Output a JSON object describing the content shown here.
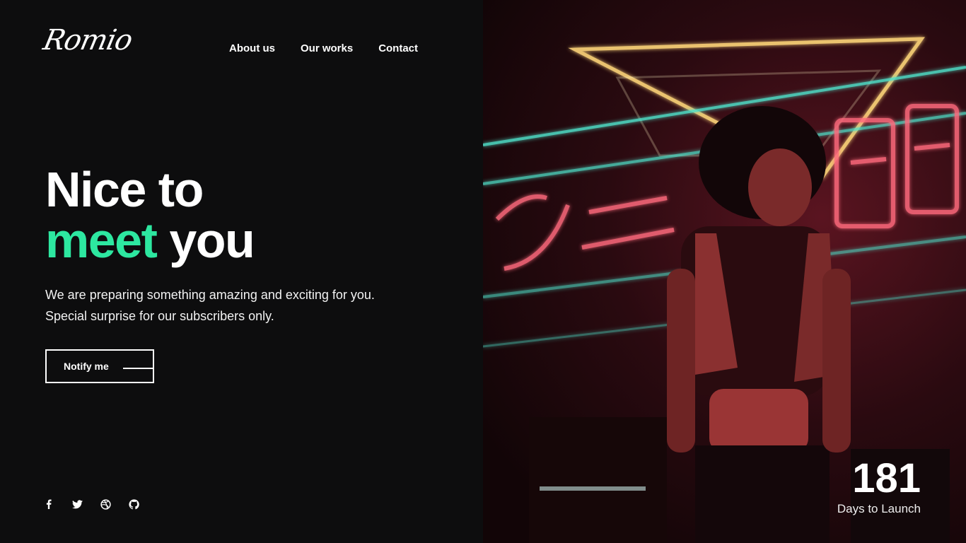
{
  "brand": {
    "logo": "Romio"
  },
  "nav": {
    "items": [
      {
        "label": "About us"
      },
      {
        "label": "Our works"
      },
      {
        "label": "Contact"
      }
    ]
  },
  "hero": {
    "line1": "Nice to",
    "accent": "meet",
    "line2_rest": " you",
    "subtext": "We are preparing something amazing and exciting for you. Special surprise for our subscribers only.",
    "cta_label": "Notify me"
  },
  "socials": [
    "facebook-icon",
    "twitter-icon",
    "dribbble-icon",
    "github-icon"
  ],
  "countdown": {
    "value": "181",
    "label": "Days to Launch"
  },
  "colors": {
    "accent": "#2de7a0",
    "background": "#0d0d0e",
    "text": "#ffffff"
  }
}
